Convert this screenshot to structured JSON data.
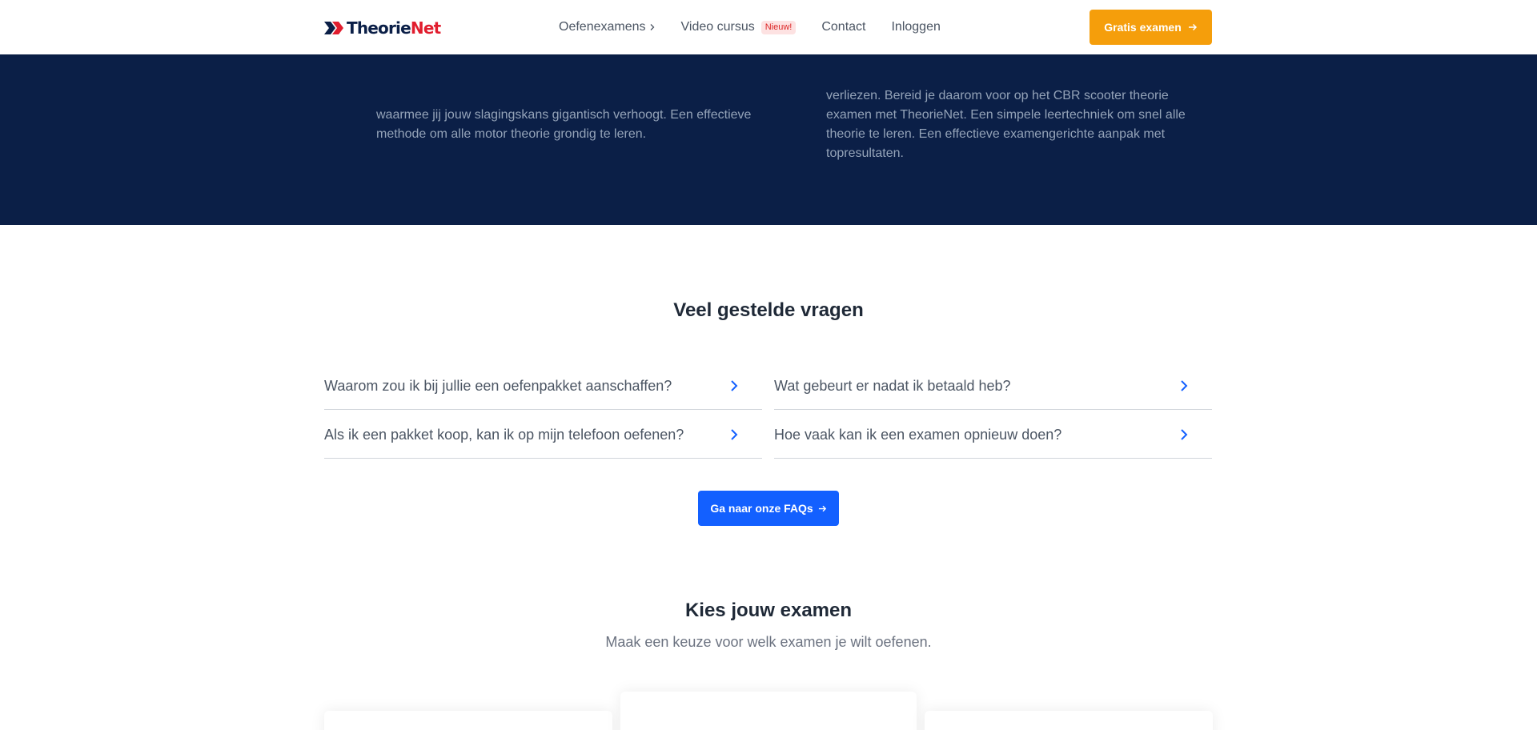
{
  "header": {
    "logo": {
      "part1": "Theorie",
      "part2": "Net"
    },
    "nav": [
      {
        "label": "Oefenexamens",
        "has_chevron": true
      },
      {
        "label": "Video cursus",
        "badge": "Nieuw!"
      },
      {
        "label": "Contact"
      },
      {
        "label": "Inloggen"
      }
    ],
    "cta_label": "Gratis examen"
  },
  "dark_band": {
    "left_lines": [
      "waarmee jij jouw slagingskans gigantisch verhoogt. Een effectieve",
      "methode om alle motor theorie grondig te leren."
    ],
    "right_lines": [
      "verliezen. Bereid je daarom voor op het CBR scooter theorie",
      "examen met TheorieNet. Een simpele leertechniek om snel alle",
      "theorie te leren. Een effectieve examengerichte aanpak met",
      "topresultaten."
    ]
  },
  "faq": {
    "title": "Veel gestelde vragen",
    "items": [
      {
        "question": "Waarom zou ik bij jullie een oefenpakket aanschaffen?"
      },
      {
        "question": "Wat gebeurt er nadat ik betaald heb?"
      },
      {
        "question": "Als ik een pakket koop, kan ik op mijn telefoon oefenen?"
      },
      {
        "question": "Hoe vaak kan ik een examen opnieuw doen?"
      }
    ],
    "button_label": "Ga naar onze FAQs"
  },
  "exams": {
    "title": "Kies jouw examen",
    "subtitle": "Maak een keuze voor welk examen je wilt oefenen."
  },
  "colors": {
    "navy": "#0b1f47",
    "brand_red": "#e11d2e",
    "cta_orange": "#f59e0b",
    "primary_blue": "#1360ff",
    "badge_bg": "#fde2e2",
    "badge_text": "#dc2626"
  }
}
